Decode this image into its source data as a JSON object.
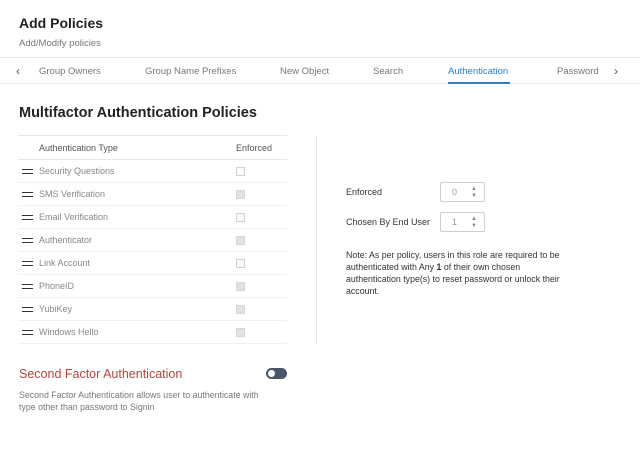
{
  "header": {
    "title": "Add Policies",
    "subtitle": "Add/Modify policies"
  },
  "tabs": {
    "prev_icon": "chevron-left-icon",
    "next_icon": "chevron-right-icon",
    "items": [
      {
        "label": "Group Owners"
      },
      {
        "label": "Group Name Prefixes"
      },
      {
        "label": "New Object"
      },
      {
        "label": "Search"
      },
      {
        "label": "Authentication",
        "active": true
      },
      {
        "label": "Password"
      }
    ],
    "accent_color": "#2f7fc1"
  },
  "mfa": {
    "title": "Multifactor Authentication Policies",
    "col_type": "Authentication Type",
    "col_enforced": "Enforced",
    "rows": [
      {
        "label": "Security Questions",
        "enforced": false
      },
      {
        "label": "SMS Verification",
        "enforced": false
      },
      {
        "label": "Email Verification",
        "enforced": false
      },
      {
        "label": "Authenticator",
        "enforced": false
      },
      {
        "label": "Link Account",
        "enforced": false
      },
      {
        "label": "PhoneID",
        "enforced": false
      },
      {
        "label": "YubiKey",
        "enforced": false
      },
      {
        "label": "Windows Hello",
        "enforced": false
      }
    ]
  },
  "settings": {
    "enforced_label": "Enforced",
    "enforced_value": "0",
    "chosen_label": "Chosen By End User",
    "chosen_value": "1",
    "note_part1": "Note: As per policy, users in this role are required to be authenticated with Any ",
    "note_bold": "1",
    "note_part2": " of their own chosen authentication type(s) to reset password or unlock their account."
  },
  "second_factor": {
    "title": "Second Factor Authentication",
    "description": "Second Factor Authentication allows user to authenticate with type other than password to Signin",
    "toggle_on": false,
    "title_color": "#b2463e"
  }
}
